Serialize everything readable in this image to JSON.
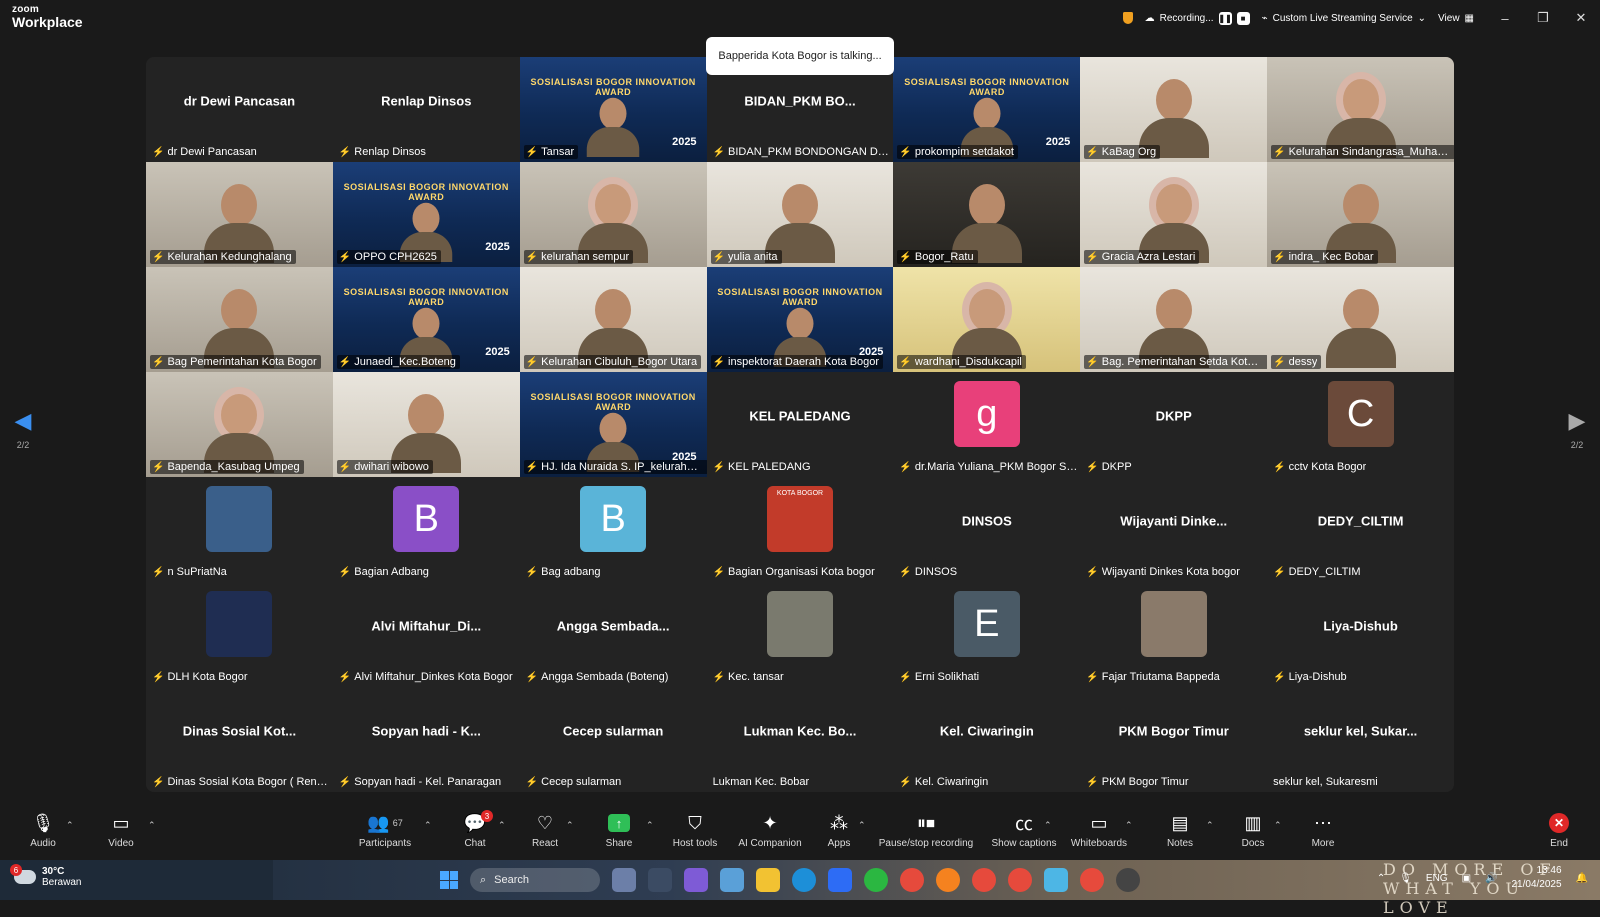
{
  "app": {
    "brand_line1": "zoom",
    "brand_line2": "Workplace"
  },
  "titlebar": {
    "recording": "Recording...",
    "streaming": "Custom Live Streaming Service",
    "view": "View",
    "minimize": "–",
    "restore": "❐",
    "close": "✕"
  },
  "talking": "Bapperida Kota Bogor is talking...",
  "pager": {
    "prev_label": "2/2",
    "next_label": "2/2"
  },
  "tiles": [
    {
      "kind": "blank",
      "center": "dr Dewi Pancasan",
      "tag": "dr Dewi Pancasan",
      "muted": true
    },
    {
      "kind": "blank",
      "center": "Renlap Dinsos",
      "tag": "Renlap Dinsos",
      "muted": true
    },
    {
      "kind": "poster",
      "tag": "Tansar",
      "muted": true
    },
    {
      "kind": "blank",
      "center": "BIDAN_PKM BO...",
      "tag": "BIDAN_PKM BONDONGAN DINK...",
      "muted": true
    },
    {
      "kind": "poster",
      "tag": "prokompim setdakot",
      "muted": true
    },
    {
      "kind": "bright",
      "tag": "KaBag Org",
      "muted": true
    },
    {
      "kind": "room",
      "tag": "Kelurahan Sindangrasa_Muhama...",
      "muted": true
    },
    {
      "kind": "room",
      "tag": "Kelurahan Kedunghalang",
      "muted": true
    },
    {
      "kind": "poster",
      "tag": "OPPO CPH2625",
      "muted": true
    },
    {
      "kind": "room",
      "tag": "kelurahan sempur",
      "muted": true
    },
    {
      "kind": "bright",
      "tag": "yulia anita",
      "muted": true
    },
    {
      "kind": "dark",
      "tag": "Bogor_Ratu",
      "muted": true
    },
    {
      "kind": "bright",
      "tag": "Gracia Azra Lestari",
      "muted": true
    },
    {
      "kind": "room",
      "tag": "indra_ Kec Bobar",
      "muted": true
    },
    {
      "kind": "room",
      "tag": "Bag Pemerintahan Kota Bogor",
      "muted": true
    },
    {
      "kind": "poster",
      "tag": "Junaedi_Kec.Boteng",
      "muted": true
    },
    {
      "kind": "bright",
      "tag": "Kelurahan Cibuluh_Bogor Utara",
      "muted": true
    },
    {
      "kind": "poster",
      "tag": "inspektorat Daerah Kota Bogor",
      "muted": true
    },
    {
      "kind": "yellow",
      "tag": "wardhani_Disdukcapil",
      "muted": true
    },
    {
      "kind": "bright",
      "tag": "Bag. Pemerintahan Setda Kota B...",
      "muted": true
    },
    {
      "kind": "bright",
      "tag": "dessy",
      "muted": true
    },
    {
      "kind": "room",
      "tag": "Bapenda_Kasubag Umpeg",
      "muted": true
    },
    {
      "kind": "bright",
      "tag": "dwihari wibowo",
      "muted": true
    },
    {
      "kind": "poster",
      "tag": "HJ. Ida Nuraida S. IP_kelurahan t...",
      "muted": true
    },
    {
      "kind": "blank",
      "center": "KEL PALEDANG",
      "tag": "KEL PALEDANG",
      "muted": true
    },
    {
      "kind": "avatar",
      "letter": "g",
      "color": "#e8407a",
      "tag": "dr.Maria Yuliana_PKM Bogor Sel...",
      "muted": true
    },
    {
      "kind": "blank",
      "center": "DKPP",
      "tag": "DKPP",
      "muted": true
    },
    {
      "kind": "avatar",
      "letter": "C",
      "color": "#6b4a3a",
      "tag": "cctv Kota Bogor",
      "muted": true
    },
    {
      "kind": "avatar",
      "letter": "",
      "color": "#3a5f8a",
      "tag": "n SuPriatNa",
      "muted": true
    },
    {
      "kind": "avatar",
      "letter": "B",
      "color": "#8a4fc7",
      "tag": "Bagian Adbang",
      "muted": true
    },
    {
      "kind": "avatar",
      "letter": "B",
      "color": "#5ab4d8",
      "tag": "Bag adbang",
      "muted": true
    },
    {
      "kind": "avatar",
      "letter": "",
      "color": "#c23b2a",
      "tag": "Bagian Organisasi Kota bogor",
      "muted": true,
      "logo_text": "KOTA BOGOR"
    },
    {
      "kind": "blank",
      "center": "DINSOS",
      "tag": "DINSOS",
      "muted": true
    },
    {
      "kind": "blank",
      "center": "Wijayanti Dinke...",
      "tag": "Wijayanti Dinkes Kota bogor",
      "muted": true
    },
    {
      "kind": "blank",
      "center": "DEDY_CILTIM",
      "tag": "DEDY_CILTIM",
      "muted": true
    },
    {
      "kind": "avatar",
      "letter": "",
      "color": "#1f2d52",
      "tag": "DLH Kota Bogor",
      "muted": true
    },
    {
      "kind": "blank",
      "center": "Alvi  Miftahur_Di...",
      "tag": "Alvi Miftahur_Dinkes Kota Bogor",
      "muted": true
    },
    {
      "kind": "blank",
      "center": "Angga  Sembada...",
      "tag": "Angga Sembada (Boteng)",
      "muted": true
    },
    {
      "kind": "avatar",
      "letter": "",
      "color": "#7a7a6e",
      "tag": "Kec. tansar",
      "muted": true
    },
    {
      "kind": "avatar",
      "letter": "E",
      "color": "#4a5a66",
      "tag": "Erni Solikhati",
      "muted": true
    },
    {
      "kind": "avatar",
      "letter": "",
      "color": "#8a7a6a",
      "tag": "Fajar Triutama Bappeda",
      "muted": true
    },
    {
      "kind": "blank",
      "center": "Liya-Dishub",
      "tag": "Liya-Dishub",
      "muted": true
    },
    {
      "kind": "blank",
      "center": "Dinas Sosial Kot...",
      "tag": "Dinas Sosial Kota Bogor ( Renlap)",
      "muted": true
    },
    {
      "kind": "blank",
      "center": "Sopyan hadi - K...",
      "tag": "Sopyan hadi - Kel. Panaragan",
      "muted": true
    },
    {
      "kind": "blank",
      "center": "Cecep sularman",
      "tag": "Cecep sularman",
      "muted": true
    },
    {
      "kind": "blank",
      "center": "Lukman Kec. Bo...",
      "tag": "Lukman Kec. Bobar",
      "muted": false
    },
    {
      "kind": "blank",
      "center": "Kel. Ciwaringin",
      "tag": "Kel. Ciwaringin",
      "muted": true
    },
    {
      "kind": "blank",
      "center": "PKM Bogor Timur",
      "tag": "PKM Bogor Timur",
      "muted": true
    },
    {
      "kind": "blank",
      "center": "seklur kel, Sukar...",
      "tag": "seklur kel, Sukaresmi",
      "muted": false
    }
  ],
  "poster": {
    "text": "SOSIALISASI BOGOR INNOVATION AWARD",
    "year": "2025"
  },
  "toolbar": {
    "audio": "Audio",
    "video": "Video",
    "participants": "Participants",
    "participants_count": "67",
    "chat": "Chat",
    "chat_badge": "3",
    "react": "React",
    "share": "Share",
    "host_tools": "Host tools",
    "ai_companion": "AI Companion",
    "apps": "Apps",
    "pause_recording": "Pause/stop recording",
    "captions": "Show captions",
    "whiteboards": "Whiteboards",
    "notes": "Notes",
    "docs": "Docs",
    "more": "More",
    "end": "End"
  },
  "taskbar": {
    "weather_temp": "30°C",
    "weather_desc": "Berawan",
    "weather_badge": "6",
    "search": "Search",
    "lang": "ENG",
    "time": "13:46",
    "date": "21/04/2025",
    "slogan": "DO MORE OF WHAT YOU LOVE"
  }
}
